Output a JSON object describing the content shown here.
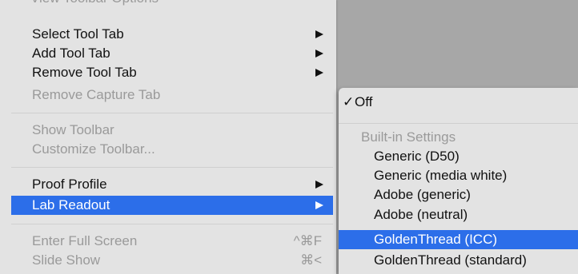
{
  "menu": {
    "cut_text": "View Toolbar Options",
    "items": [
      {
        "label": "Select Tool Tab",
        "submenu": true,
        "disabled": false
      },
      {
        "label": "Add Tool Tab",
        "submenu": true,
        "disabled": false
      },
      {
        "label": "Remove Tool Tab",
        "submenu": true,
        "disabled": false
      },
      {
        "label": "Remove Capture Tab",
        "submenu": false,
        "disabled": true
      },
      {
        "label": "Show Toolbar",
        "submenu": false,
        "disabled": true
      },
      {
        "label": "Customize Toolbar...",
        "submenu": false,
        "disabled": true
      },
      {
        "label": "Proof Profile",
        "submenu": true,
        "disabled": false
      },
      {
        "label": "Lab Readout",
        "submenu": true,
        "disabled": false,
        "selected": true
      },
      {
        "label": "Enter Full Screen",
        "shortcut": "^⌘F",
        "disabled": true
      },
      {
        "label": "Slide Show",
        "shortcut": "⌘<",
        "disabled": true
      }
    ]
  },
  "submenu": {
    "off_check": "✓",
    "off_label": "Off",
    "header": "Built-in Settings",
    "options": [
      "Generic (D50)",
      "Generic (media white)",
      "Adobe (generic)",
      "Adobe (neutral)",
      "GoldenThread (ICC)",
      "GoldenThread (standard)"
    ],
    "selected_option": "GoldenThread (ICC)"
  },
  "colors": {
    "highlight": "#2c6ee9",
    "menu_bg": "#e3e3e3",
    "disabled_text": "#9a9a9a"
  }
}
